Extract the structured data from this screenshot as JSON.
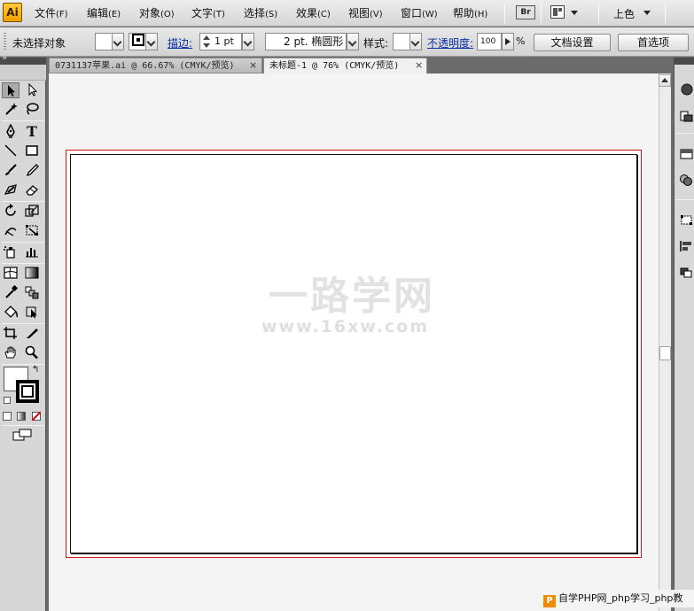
{
  "app": {
    "logo": "Ai",
    "bridge_label": "Br"
  },
  "menu": {
    "items": [
      {
        "label": "文件",
        "accel": "(F)"
      },
      {
        "label": "编辑",
        "accel": "(E)"
      },
      {
        "label": "对象",
        "accel": "(O)"
      },
      {
        "label": "文字",
        "accel": "(T)"
      },
      {
        "label": "选择",
        "accel": "(S)"
      },
      {
        "label": "效果",
        "accel": "(C)"
      },
      {
        "label": "视图",
        "accel": "(V)"
      },
      {
        "label": "窗口",
        "accel": "(W)"
      },
      {
        "label": "帮助",
        "accel": "(H)"
      }
    ],
    "workspace": "上色"
  },
  "control": {
    "selection_status": "未选择对象",
    "stroke_label": "描边:",
    "stroke_weight": "1 pt",
    "brush": "2 pt. 椭圆形",
    "style_label": "样式:",
    "opacity_label": "不透明度:",
    "opacity_value": "100",
    "percent": "%",
    "doc_setup_button": "文档设置",
    "prefs_button": "首选项"
  },
  "tabs": [
    {
      "label": "0731137苹果.ai @ 66.67% (CMYK/预览)",
      "active": false
    },
    {
      "label": "未标题-1 @ 76% (CMYK/预览)",
      "active": true
    }
  ],
  "tab_close_glyph": "×",
  "tools": {
    "selection": "selection-arrow-icon",
    "type_glyph": "T"
  },
  "watermark": {
    "line1": "一路学网",
    "line2": "www.16xw.com"
  },
  "footer": {
    "logo": "P",
    "text": "自学PHP网_php学习_php教"
  },
  "colors": {
    "bleed_guide": "#d41414",
    "accent_logo": "#f0a200"
  }
}
